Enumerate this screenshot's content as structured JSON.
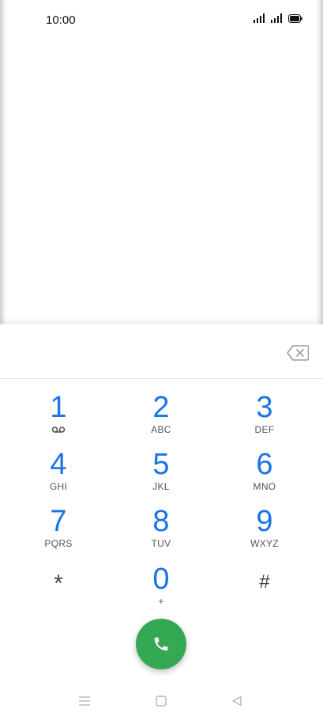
{
  "status_bar": {
    "time": "10:00",
    "icons": [
      "signal-icon",
      "signal-icon",
      "battery-icon"
    ]
  },
  "dialpad": {
    "keys": [
      {
        "digit": "1",
        "letters": "",
        "icon": "voicemail-icon"
      },
      {
        "digit": "2",
        "letters": "ABC"
      },
      {
        "digit": "3",
        "letters": "DEF"
      },
      {
        "digit": "4",
        "letters": "GHI"
      },
      {
        "digit": "5",
        "letters": "JKL"
      },
      {
        "digit": "6",
        "letters": "MNO"
      },
      {
        "digit": "7",
        "letters": "PQRS"
      },
      {
        "digit": "8",
        "letters": "TUV"
      },
      {
        "digit": "9",
        "letters": "WXYZ"
      },
      {
        "digit": "*",
        "letters": ""
      },
      {
        "digit": "0",
        "letters": "+"
      },
      {
        "digit": "#",
        "letters": ""
      }
    ],
    "backspace_icon": "backspace-icon",
    "call_icon": "phone-icon"
  },
  "colors": {
    "accent": "#1a73e8",
    "call_button": "#34a853",
    "letters": "#555555"
  },
  "nav_bar": {
    "icons": [
      "menu-icon",
      "home-icon",
      "back-icon"
    ]
  }
}
